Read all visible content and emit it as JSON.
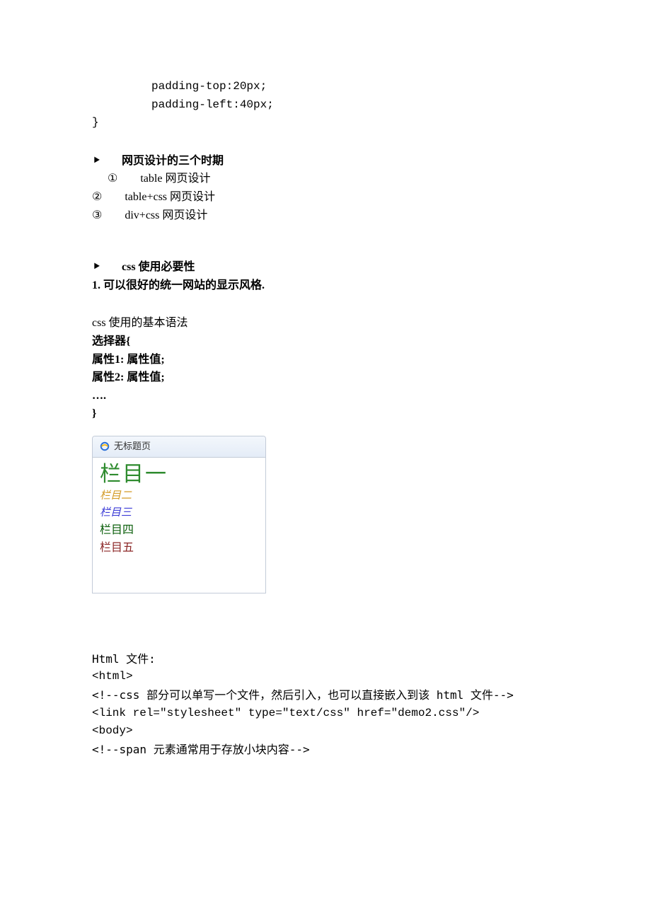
{
  "code_top": {
    "line1": "padding-top:20px;",
    "line2": "padding-left:40px;",
    "close": "}"
  },
  "section1": {
    "bullet": "⯈",
    "title": "网页设计的三个时期",
    "items": [
      {
        "mark": "①",
        "text": "table 网页设计"
      },
      {
        "mark": "②",
        "text": "table+css 网页设计"
      },
      {
        "mark": "③",
        "text": "div+css 网页设计"
      }
    ]
  },
  "section2": {
    "bullet": "⯈",
    "title": "css 使用必要性",
    "point_num": "1.",
    "point_text": "可以很好的统一网站的显示风格."
  },
  "syntax": {
    "title": "css 使用的基本语法",
    "line1": "选择器{",
    "line2": "属性1: 属性值;",
    "line3": "属性2: 属性值;",
    "line4": "….",
    "line5": "}"
  },
  "browser": {
    "tab_title": "无标题页",
    "items": [
      "栏目一",
      "栏目二",
      "栏目三",
      "栏目四",
      "栏目五"
    ]
  },
  "htmlfile": {
    "label": "Html 文件:",
    "line1": "<html>",
    "line2": "<!--css 部分可以单写一个文件，然后引入，也可以直接嵌入到该 html 文件-->",
    "line3": "<link rel=\"stylesheet\" type=\"text/css\" href=\"demo2.css\"/>",
    "line4": "<body>",
    "line5": "<!--span 元素通常用于存放小块内容-->"
  }
}
